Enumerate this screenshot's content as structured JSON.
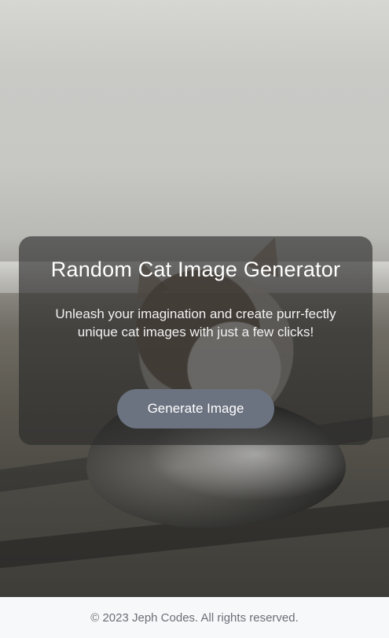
{
  "hero": {
    "background_image": "cat-photo",
    "card": {
      "title": "Random Cat Image Generator",
      "subtitle": "Unleash your imagination and create purr-fectly unique cat images with just a few clicks!",
      "button_label": "Generate Image"
    }
  },
  "footer": {
    "text": "© 2023 Jeph Codes. All rights reserved."
  },
  "colors": {
    "button_bg": "#6b7280",
    "card_bg": "rgba(40,40,40,0.62)",
    "footer_bg": "#f7f8fa",
    "footer_text": "#6b6f76"
  }
}
